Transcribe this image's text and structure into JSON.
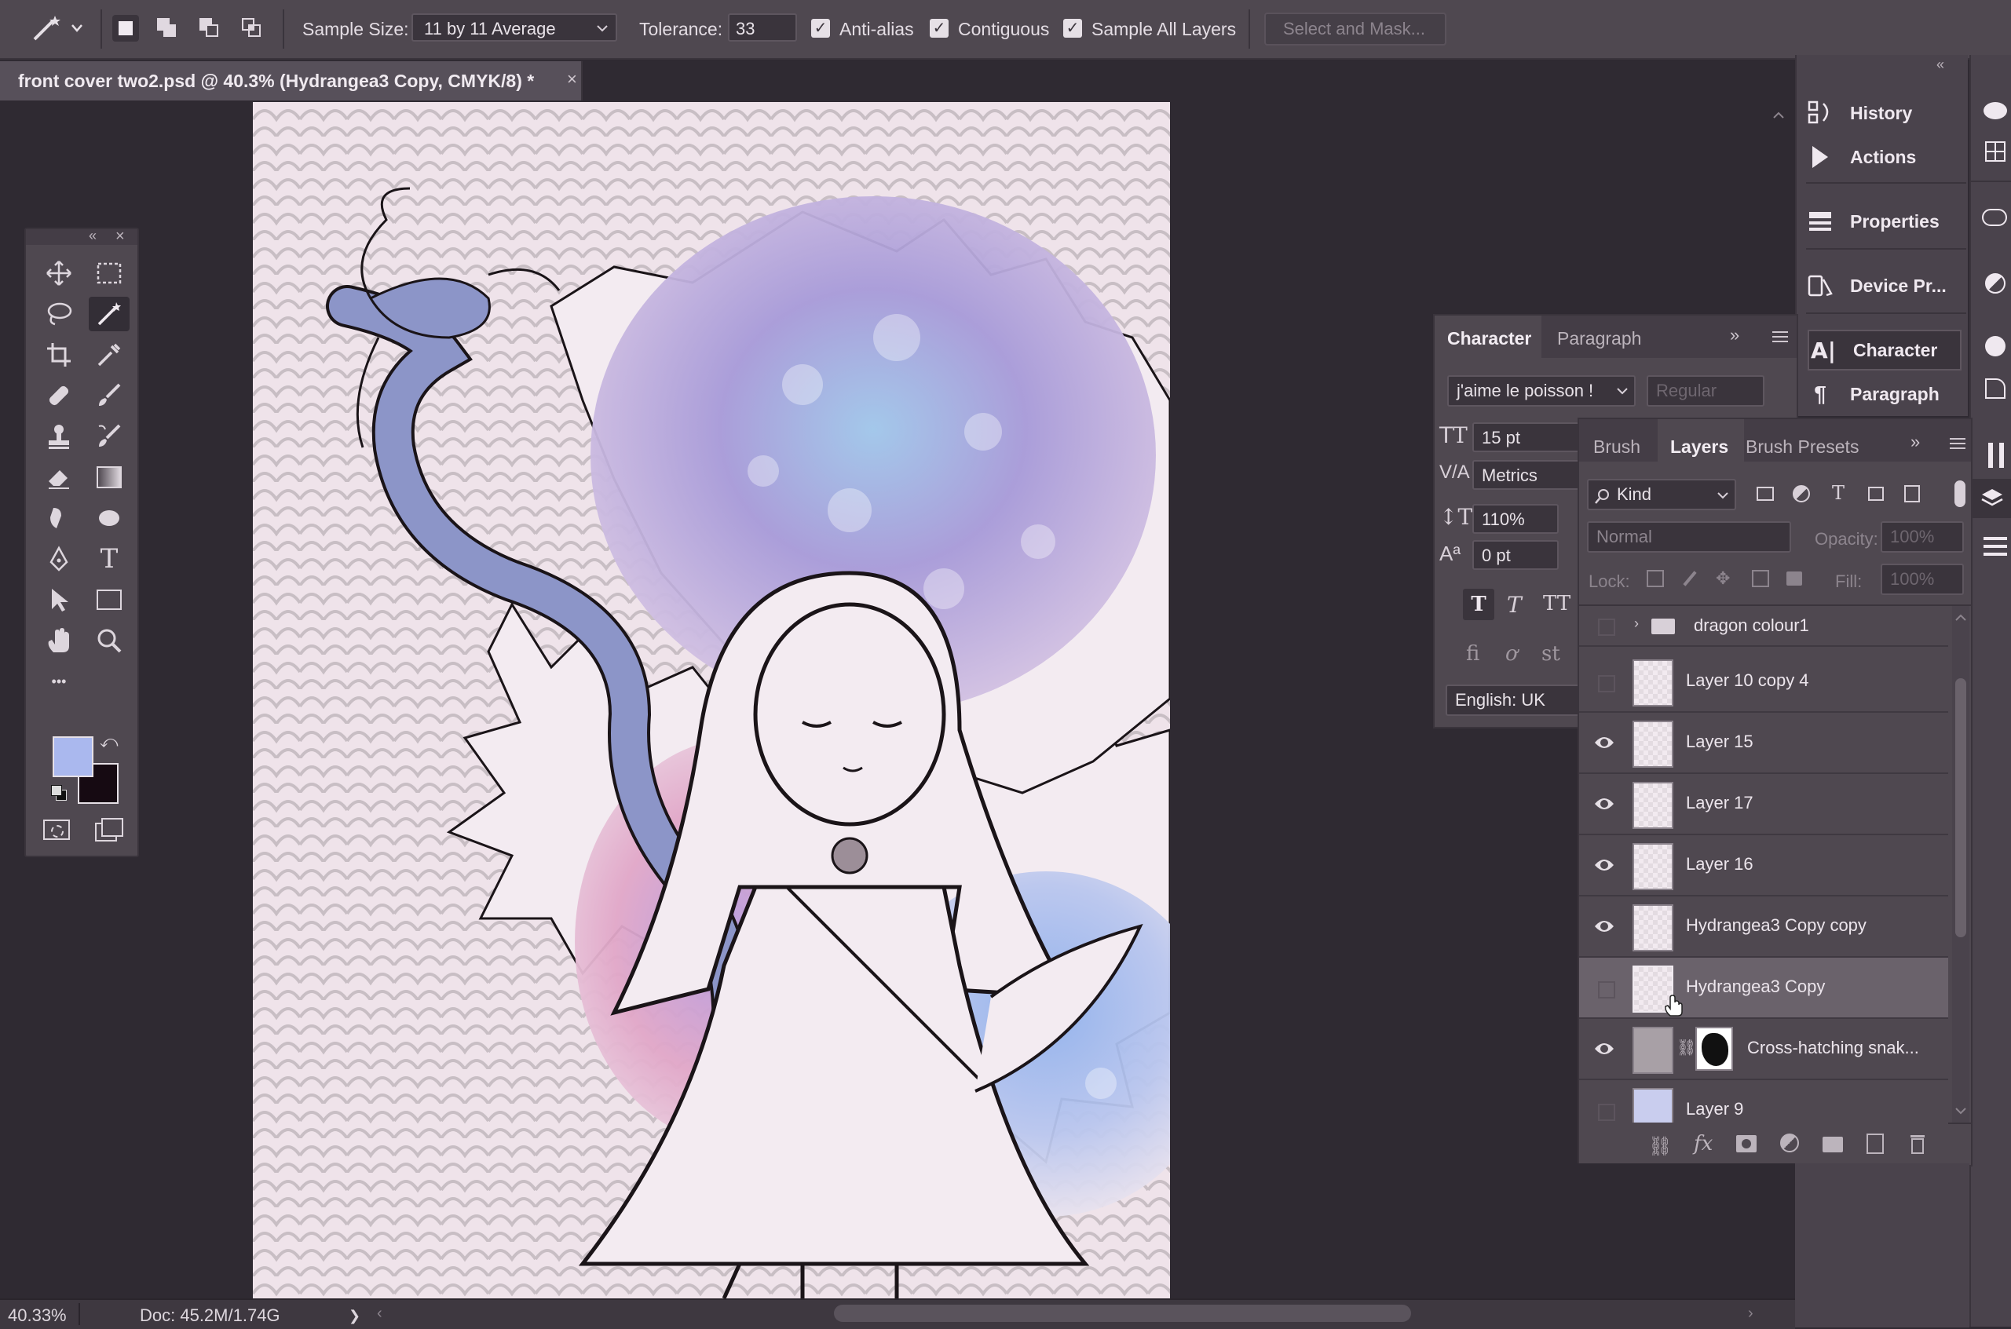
{
  "options_bar": {
    "sample_size_label": "Sample Size:",
    "sample_size_value": "11 by 11 Average",
    "tolerance_label": "Tolerance:",
    "tolerance_value": "33",
    "anti_alias_label": "Anti-alias",
    "contiguous_label": "Contiguous",
    "sample_all_layers_label": "Sample All Layers",
    "select_and_mask_label": "Select and Mask..."
  },
  "document": {
    "tab_title": "front cover two2.psd @ 40.3% (Hydrangea3 Copy, CMYK/8) *",
    "close_glyph": "×"
  },
  "toolbox": {
    "more_tools": "•••",
    "foreground_color": "#aab8ee",
    "background_color": "#160a12"
  },
  "right_column": {
    "items": [
      {
        "label": "History",
        "icon": "history-icon"
      },
      {
        "label": "Actions",
        "icon": "play-icon"
      },
      {
        "label": "Properties",
        "icon": "properties-icon"
      },
      {
        "label": "Device Pr...",
        "icon": "device-preview-icon"
      },
      {
        "label": "Character",
        "icon": "character-icon"
      },
      {
        "label": "Paragraph",
        "icon": "paragraph-icon"
      }
    ]
  },
  "character_panel": {
    "tab_character": "Character",
    "tab_paragraph": "Paragraph",
    "font_family": "j'aime le poisson !",
    "font_style": "Regular",
    "font_size": "15 pt",
    "kerning": "Metrics",
    "vertical_scale": "110%",
    "baseline_shift": "0 pt",
    "language": "English: UK"
  },
  "layers_panel": {
    "tab_brush": "Brush",
    "tab_layers": "Layers",
    "tab_brush_presets": "Brush Presets",
    "filter_kind": "Kind",
    "blend_mode": "Normal",
    "opacity_label": "Opacity:",
    "opacity_value": "100%",
    "lock_label": "Lock:",
    "fill_label": "Fill:",
    "fill_value": "100%",
    "layers": [
      {
        "name": "dragon colour1",
        "visible": false,
        "type": "group"
      },
      {
        "name": "Layer 10 copy 4",
        "visible": false
      },
      {
        "name": "Layer 15",
        "visible": true
      },
      {
        "name": "Layer 17",
        "visible": true
      },
      {
        "name": "Layer 16",
        "visible": true
      },
      {
        "name": "Hydrangea3 Copy copy",
        "visible": true
      },
      {
        "name": "Hydrangea3 Copy",
        "visible": false,
        "selected": true
      },
      {
        "name": "Cross-hatching snak...",
        "visible": true,
        "has_mask": true
      },
      {
        "name": "Layer 9",
        "visible": false
      }
    ]
  },
  "status_bar": {
    "zoom": "40.33%",
    "doc_size": "Doc: 45.2M/1.74G",
    "arrow": "❯"
  },
  "colors": {
    "app_bg": "#2f2a32",
    "panel_bg": "#4f4850",
    "canvas_bg": "#efe3ea",
    "selected_row": "#6a626b"
  }
}
